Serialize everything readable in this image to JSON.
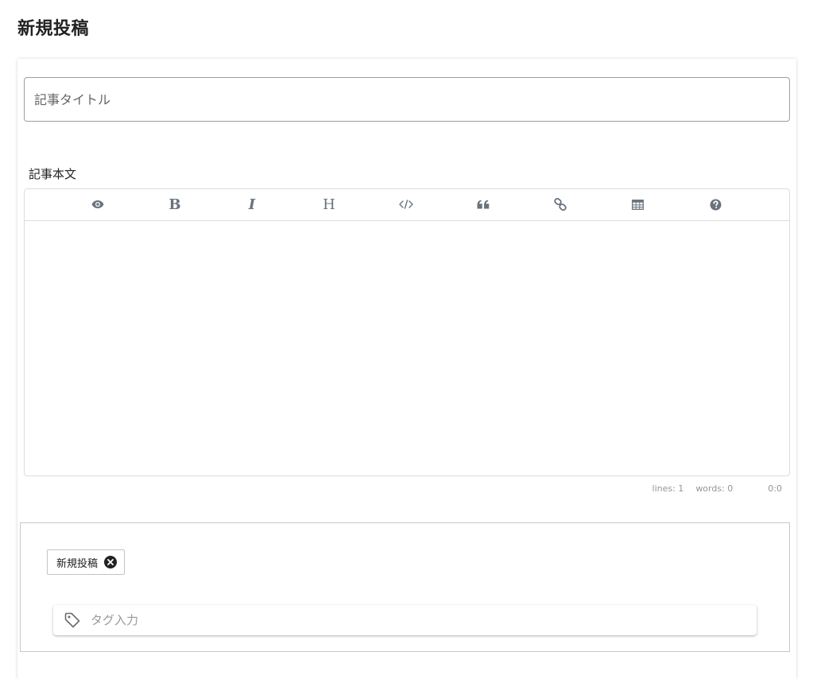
{
  "page": {
    "title": "新規投稿"
  },
  "title_field": {
    "placeholder": "記事タイトル",
    "value": ""
  },
  "body_field": {
    "label": "記事本文",
    "value": ""
  },
  "editor_toolbar": [
    {
      "name": "preview",
      "icon": "eye-icon"
    },
    {
      "name": "bold",
      "icon": "bold-icon",
      "glyph": "B"
    },
    {
      "name": "italic",
      "icon": "italic-icon",
      "glyph": "I"
    },
    {
      "name": "heading",
      "icon": "heading-icon",
      "glyph": "H"
    },
    {
      "name": "code",
      "icon": "code-icon"
    },
    {
      "name": "quote",
      "icon": "quote-icon"
    },
    {
      "name": "link",
      "icon": "link-icon"
    },
    {
      "name": "table",
      "icon": "table-icon"
    },
    {
      "name": "guide",
      "icon": "question-circle-icon"
    }
  ],
  "statusbar": {
    "lines": "lines: 1",
    "words": "words: 0",
    "cursor": "0:0"
  },
  "tags": {
    "items": [
      {
        "label": "新規投稿"
      }
    ],
    "input_placeholder": "タグ入力",
    "input_value": ""
  },
  "colors": {
    "icon": "#6a737d",
    "border": "#dddddd",
    "title_border": "#9e9e9e"
  }
}
